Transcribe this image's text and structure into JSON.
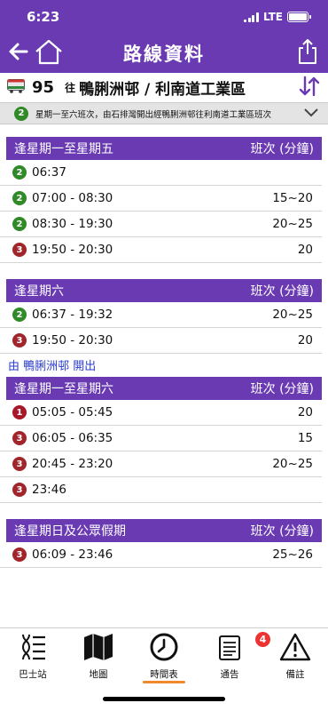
{
  "status": {
    "time": "6:23",
    "network": "LTE"
  },
  "header": {
    "title": "路線資料"
  },
  "route": {
    "number": "95",
    "to_prefix": "往",
    "destination": "鴨脷洲邨 / 利南道工業區"
  },
  "variant": {
    "badge": "2",
    "text": "星期一至六班次，由石排灣開出經鴨脷洲邨往利南道工業區班次"
  },
  "sections_a": [
    {
      "title": "逢星期一至星期五",
      "freq_label": "班次 (分鐘)",
      "rows": [
        {
          "badge": "2",
          "time": "06:37",
          "freq": ""
        },
        {
          "badge": "2",
          "time": "07:00 - 08:30",
          "freq": "15~20"
        },
        {
          "badge": "2",
          "time": "08:30 - 19:30",
          "freq": "20~25"
        },
        {
          "badge": "3",
          "time": "19:50 - 20:30",
          "freq": "20"
        }
      ]
    },
    {
      "title": "逢星期六",
      "freq_label": "班次 (分鐘)",
      "rows": [
        {
          "badge": "2",
          "time": "06:37 - 19:32",
          "freq": "20~25"
        },
        {
          "badge": "3",
          "time": "19:50 - 20:30",
          "freq": "20"
        }
      ]
    }
  ],
  "direction_label": "由 鴨脷洲邨 開出",
  "sections_b": [
    {
      "title": "逢星期一至星期六",
      "freq_label": "班次 (分鐘)",
      "rows": [
        {
          "badge": "1",
          "time": "05:05 - 05:45",
          "freq": "20"
        },
        {
          "badge": "3",
          "time": "06:05 - 06:35",
          "freq": "15"
        },
        {
          "badge": "3",
          "time": "20:45 - 23:20",
          "freq": "20~25"
        },
        {
          "badge": "3",
          "time": "23:46",
          "freq": ""
        }
      ]
    },
    {
      "title": "逢星期日及公眾假期",
      "freq_label": "班次 (分鐘)",
      "rows": [
        {
          "badge": "3",
          "time": "06:09 - 23:46",
          "freq": "25~26"
        }
      ]
    }
  ],
  "tabs": [
    {
      "label": "巴士站",
      "icon": "bus-stop-icon"
    },
    {
      "label": "地圖",
      "icon": "map-icon"
    },
    {
      "label": "時間表",
      "icon": "clock-icon",
      "active": true
    },
    {
      "label": "通告",
      "icon": "notice-icon",
      "badge": "4"
    },
    {
      "label": "備註",
      "icon": "warning-icon"
    }
  ],
  "colors": {
    "accent": "#6a3ab3",
    "active_tab": "#f0892a",
    "direction_text": "#2a3dd0"
  }
}
